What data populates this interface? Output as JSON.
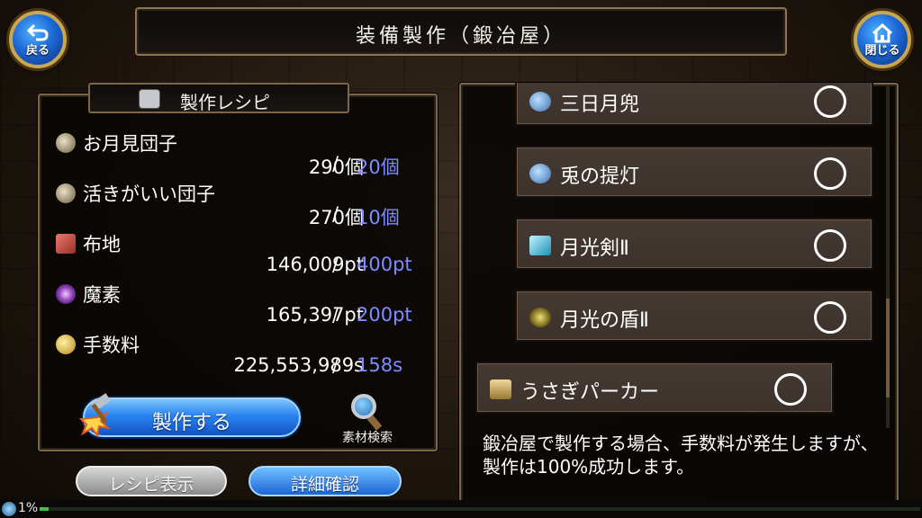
{
  "header": {
    "title": "装備製作（鍛冶屋）"
  },
  "nav": {
    "back_label": "戻る",
    "close_label": "閉じる"
  },
  "recipe": {
    "title": "製作レシピ",
    "materials": [
      {
        "name": "お月見団子",
        "have": "290個",
        "need": "20個",
        "icon": "dumpling-bag-icon"
      },
      {
        "name": "活きがいい団子",
        "have": "270個",
        "need": "10個",
        "icon": "dumpling-bag-icon"
      },
      {
        "name": "布地",
        "have": "146,009pt",
        "need": "400pt",
        "icon": "cloth-icon"
      },
      {
        "name": "魔素",
        "have": "165,397pt",
        "need": "200pt",
        "icon": "magic-orb-icon"
      },
      {
        "name": "手数料",
        "have": "225,553,989s",
        "need": "158s",
        "icon": "coins-icon"
      }
    ],
    "separator": "/",
    "craft_label": "製作する",
    "search_label": "素材検索"
  },
  "bottom_buttons": {
    "recipe_display": "レシピ表示",
    "details": "詳細確認"
  },
  "items": [
    {
      "name": "三日月兜",
      "icon": "helmet-icon"
    },
    {
      "name": "兎の提灯",
      "icon": "helmet-icon"
    },
    {
      "name": "月光剣Ⅱ",
      "icon": "sword-icon"
    },
    {
      "name": "月光の盾Ⅱ",
      "icon": "shield-icon"
    },
    {
      "name": "うさぎパーカー",
      "icon": "parka-icon"
    }
  ],
  "description": "鍛冶屋で製作する場合、手数料が発生しますが、製作は100%成功します。",
  "footer": {
    "progress_text": "1%",
    "progress": 0.01
  },
  "colors": {
    "need_value": "#7e8cff",
    "accent_blue": "#2a84f0",
    "frame": "#7b6648"
  }
}
